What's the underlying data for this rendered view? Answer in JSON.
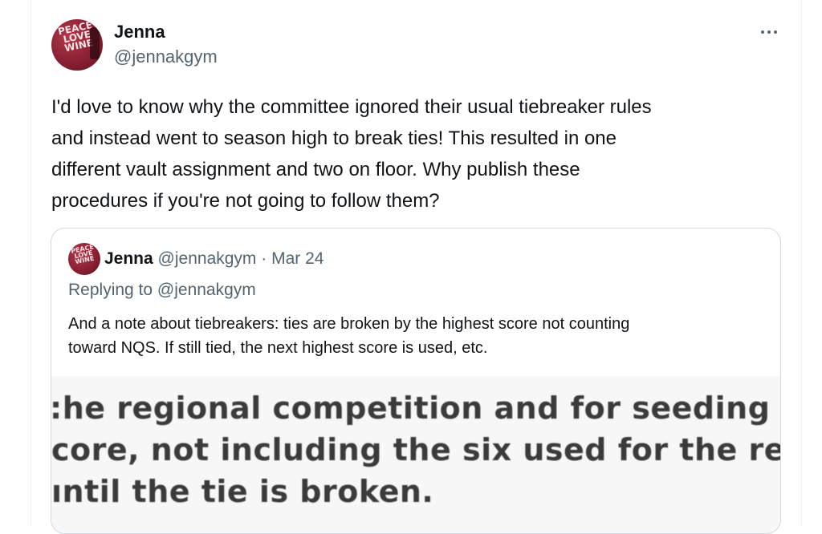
{
  "tweet": {
    "author_name": "Jenna",
    "author_handle": "@jennakgym",
    "avatar_text": [
      "PEACE",
      "LOVE",
      "WINE"
    ],
    "more_icon": "more-horizontal-icon",
    "text": "I'd love to know why the committee ignored their usual tiebreaker rules\nand instead went to season high to break ties! This resulted in one\ndifferent vault assignment and two on floor. Why publish these\nprocedures if you're not going to follow them?"
  },
  "quoted_tweet": {
    "author_name": "Jenna",
    "author_handle": "@jennakgym",
    "separator": "·",
    "date": "Mar 24",
    "replying_prefix": "Replying to",
    "replying_handle": "@jennakgym",
    "text": "And a note about tiebreakers: ties are broken by the highest score not counting\ntoward NQS. If still tied, the next highest score is used, etc.",
    "image_lines": [
      ":he regional competition and for seeding purpo",
      "core, not including the six used for the regiona",
      "ıntil the tie is broken."
    ]
  },
  "colors": {
    "text_primary": "#0f1419",
    "text_secondary": "#536471",
    "border": "#cfd9de",
    "avatar_bg": "#8a1f33"
  }
}
